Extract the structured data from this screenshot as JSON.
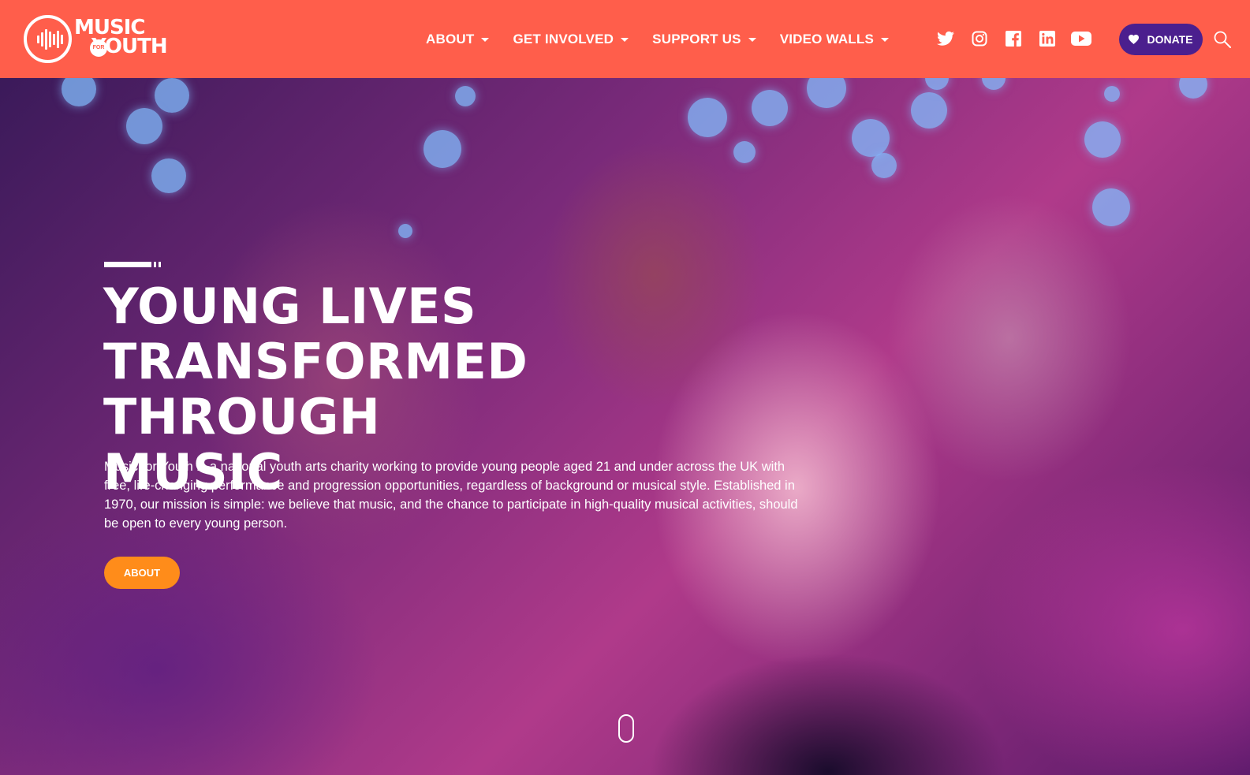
{
  "header": {
    "logo": {
      "line1": "MUSIC",
      "for": "FOR",
      "line2": "YOUTH"
    },
    "nav": [
      {
        "label": "ABOUT"
      },
      {
        "label": "GET INVOLVED"
      },
      {
        "label": "SUPPORT US"
      },
      {
        "label": "VIDEO WALLS"
      }
    ],
    "social_icons": [
      "twitter-icon",
      "instagram-icon",
      "facebook-icon",
      "linkedin-icon",
      "youtube-icon"
    ],
    "donate_label": "DONATE",
    "search_icon": "search-icon"
  },
  "hero": {
    "headline": [
      "YOUNG LIVES",
      "TRANSFORMED THROUGH",
      "MUSIC"
    ],
    "intro": "Music for Youth is a national youth arts charity working to provide young people aged 21 and under across the UK with free, life-changing performance and progression opportunities, regardless of background or musical style. Established in 1970, our mission is simple: we believe that music, and the chance to participate in high-quality musical activities, should be open to every young person.",
    "cta_label": "ABOUT"
  },
  "colors": {
    "header_bg": "#ff5e4b",
    "donate_bg": "#4b1f8e",
    "cta_bg": "#ff8c1a",
    "text": "#ffffff"
  }
}
